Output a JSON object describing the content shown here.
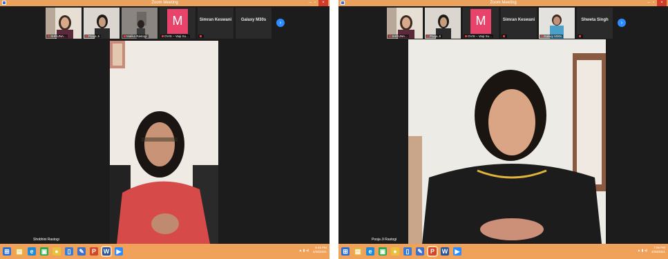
{
  "window": {
    "title": "Zoom Meeting"
  },
  "left": {
    "tiles": [
      {
        "kind": "photo",
        "name": "SHRUNA..."
      },
      {
        "kind": "photo",
        "name": "Pooja Ji"
      },
      {
        "kind": "photo",
        "name": "Malika Rastogi"
      },
      {
        "kind": "letter",
        "letter": "M",
        "name": "OVIS – Vaqi Su..."
      },
      {
        "kind": "text",
        "name": "Simran Keswani"
      },
      {
        "kind": "text",
        "name": "Galaxy M30s"
      }
    ],
    "speaker_label": "Shobhini Rastogi",
    "tray_time": "6:45 PM",
    "tray_date": "4/28/2021"
  },
  "right": {
    "tiles": [
      {
        "kind": "photo",
        "name": "SHRUNA..."
      },
      {
        "kind": "photo",
        "name": "Pooja Ji"
      },
      {
        "kind": "letter",
        "letter": "M",
        "name": "OVIS – Vaqi Su..."
      },
      {
        "kind": "text",
        "name": "Simran Keswani"
      },
      {
        "kind": "photo",
        "name": "Galaxy M30s"
      },
      {
        "kind": "text",
        "name": "Shweta Singh"
      }
    ],
    "speaker_label": "Pooja Ji Rastogi",
    "tray_time": "7:06 PM",
    "tray_date": "4/28/2021"
  },
  "colors": {
    "titlebar": "#e9a15c",
    "taskbar": "#f0a15a",
    "zoom_blue": "#2d8cff",
    "badge_pink": "#e8436a"
  },
  "taskbar_icons": [
    "start-icon",
    "explorer-icon",
    "ie-icon",
    "store-icon",
    "chrome-icon",
    "file-icon",
    "pen-icon",
    "powerpoint-icon",
    "word-icon",
    "zoom-icon"
  ]
}
